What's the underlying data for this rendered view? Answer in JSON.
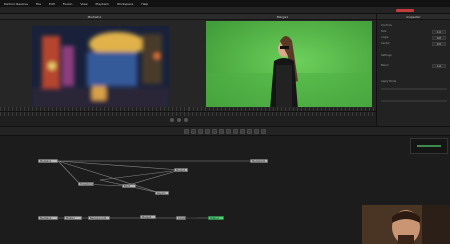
{
  "menubar": {
    "items": [
      "DaVinci Resolve",
      "File",
      "Edit",
      "Fusion",
      "View",
      "Playback",
      "Workspace",
      "Help"
    ]
  },
  "viewers": {
    "left_title": "MediaIn1",
    "right_title": "Merge1",
    "left_image_desc": "blurred city street at night",
    "right_image_desc": "woman on green screen"
  },
  "inspector": {
    "title": "Inspector",
    "section1": "Controls",
    "section2": "Settings",
    "field_labels": [
      "Size",
      "Angle",
      "Center",
      "Blend",
      "Apply Mode"
    ],
    "values": [
      "1.0",
      "0.0",
      "0.5",
      "1.0"
    ]
  },
  "nodes": {
    "labels": [
      "MediaIn1",
      "MediaIn2",
      "Merge1",
      "Transform1",
      "Blur1",
      "MediaOut1",
      "Keyer1",
      "Matte1",
      "Background1",
      "Merge2",
      "ColorCorrector1",
      "Output"
    ]
  },
  "colors": {
    "green_screen": "#58c14a",
    "node_default": "#b8b8b8",
    "node_active": "#54d07a",
    "accent_red": "#c43b3b"
  }
}
